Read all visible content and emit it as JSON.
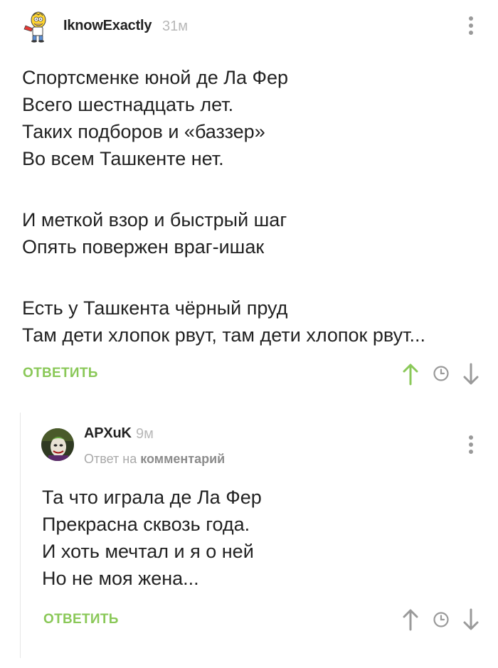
{
  "comment1": {
    "author": "IknowExactly",
    "time": "31м",
    "lines": [
      "Спортсменке юной де Ла Фер",
      "Всего шестнадцать лет.",
      "Таких подборов и «баззер»",
      "Во всем Ташкенте нет.",
      "",
      "И меткой взор и быстрый шаг",
      "Опять повержен враг-ишак",
      "",
      "Есть у Ташкента чёрный пруд",
      "Там дети хлопок рвут, там дети хлопок рвут..."
    ],
    "reply_label": "ОТВЕТИТЬ",
    "upvote_active": true
  },
  "comment2": {
    "author": "APXuK",
    "time": "9м",
    "reply_prefix": "Ответ на",
    "reply_target": "комментарий",
    "lines": [
      "Та что играла де Ла Фер",
      "Прекрасна сквозь года.",
      "И хоть мечтал и я о ней",
      "Но не моя жена..."
    ],
    "reply_label": "ОТВЕТИТЬ",
    "upvote_active": false
  },
  "colors": {
    "accent_green": "#8ac858",
    "icon_gray": "#9a9a9a",
    "meta_gray": "#b0b0b0"
  },
  "icons": [
    "homer-avatar",
    "joker-avatar",
    "more-vertical-icon",
    "upvote-arrow-icon",
    "clock-icon",
    "downvote-arrow-icon"
  ]
}
